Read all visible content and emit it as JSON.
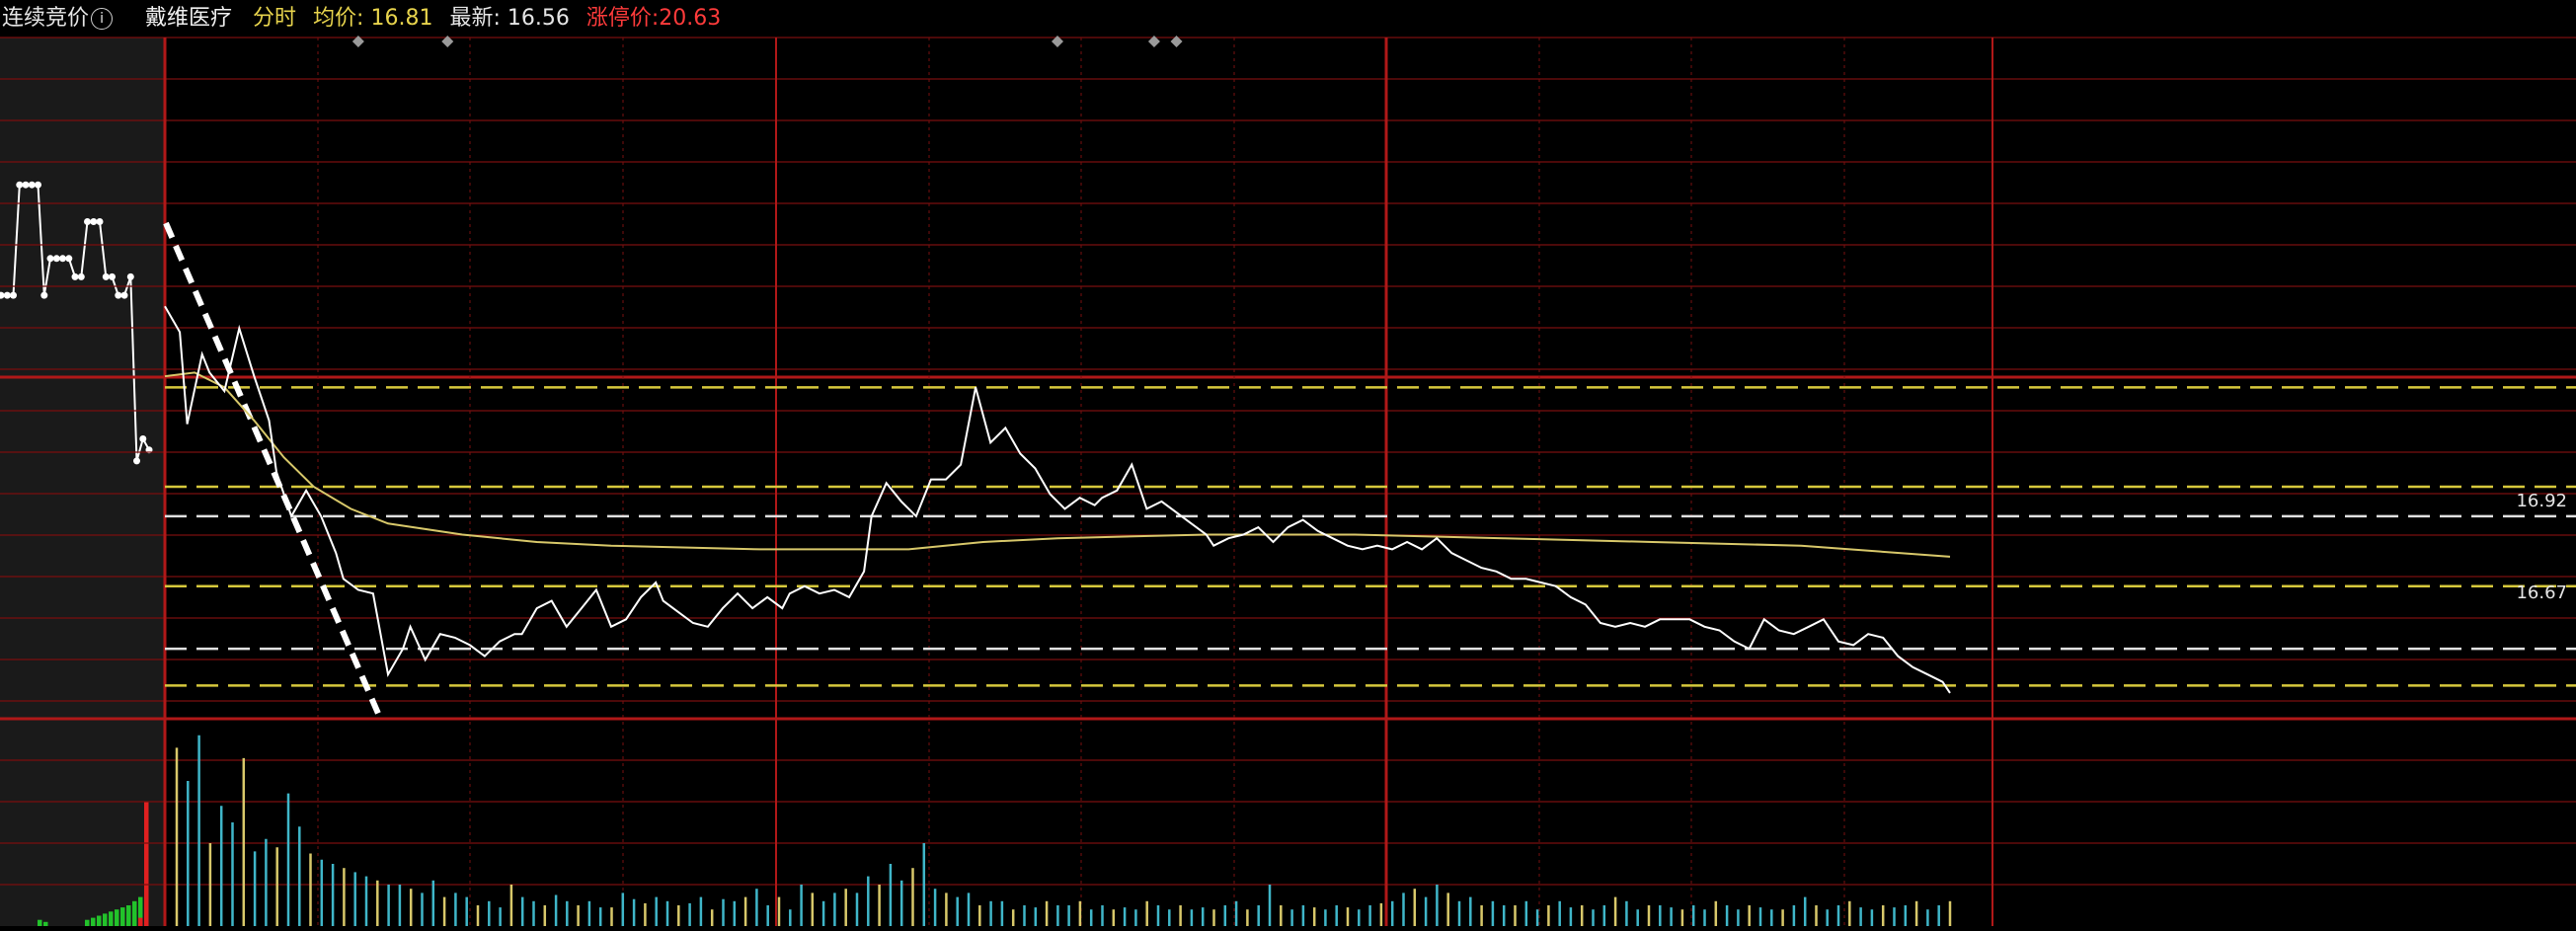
{
  "header": {
    "auction_label": "连续竞价",
    "stock_name": "戴维医疗",
    "mode_label": "分时",
    "avg_label": "均价:",
    "avg_value": "16.81",
    "last_label": "最新:",
    "last_value": "16.56",
    "limit_label": "涨停价:",
    "limit_value": "20.63"
  },
  "colors": {
    "background": "#000000",
    "grid": "#7a0f0f",
    "grid_strong": "#b01818",
    "price_line": "#ffffff",
    "avg_line": "#d8c86a",
    "dashed_white": "#e0e0e0",
    "dashed_yellow": "#d6c83c",
    "volume_cyan": "#3fb6c9",
    "volume_yellow": "#d8c86a",
    "auction_bg": "#1a1a1a",
    "auction_green": "#22c22a",
    "auction_red": "#e02020"
  },
  "chart_data": {
    "type": "line",
    "price_labels": [
      {
        "text": "16.92",
        "value": 16.92
      },
      {
        "text": "16.67",
        "value": 16.67
      }
    ],
    "horizontal_levels": [
      {
        "value": 17.27,
        "style": "yellow-dashed"
      },
      {
        "value": 17.0,
        "style": "yellow-dashed"
      },
      {
        "value": 16.92,
        "style": "white-dashed"
      },
      {
        "value": 16.73,
        "style": "yellow-dashed"
      },
      {
        "value": 16.56,
        "style": "white-dashed"
      },
      {
        "value": 16.46,
        "style": "yellow-dashed"
      }
    ],
    "price_range": [
      16.37,
      18.22
    ],
    "minutes_total": 240,
    "price": [
      [
        0,
        17.49
      ],
      [
        2,
        17.42
      ],
      [
        3,
        17.17
      ],
      [
        5,
        17.36
      ],
      [
        6,
        17.31
      ],
      [
        8,
        17.26
      ],
      [
        10,
        17.43
      ],
      [
        12,
        17.3
      ],
      [
        14,
        17.18
      ],
      [
        15,
        17.04
      ],
      [
        17,
        16.92
      ],
      [
        19,
        16.99
      ],
      [
        21,
        16.92
      ],
      [
        23,
        16.82
      ],
      [
        24,
        16.75
      ],
      [
        26,
        16.72
      ],
      [
        28,
        16.71
      ],
      [
        30,
        16.49
      ],
      [
        32,
        16.56
      ],
      [
        33,
        16.62
      ],
      [
        35,
        16.53
      ],
      [
        37,
        16.6
      ],
      [
        39,
        16.59
      ],
      [
        41,
        16.57
      ],
      [
        43,
        16.54
      ],
      [
        45,
        16.58
      ],
      [
        47,
        16.6
      ],
      [
        48,
        16.6
      ],
      [
        50,
        16.67
      ],
      [
        52,
        16.69
      ],
      [
        54,
        16.62
      ],
      [
        56,
        16.67
      ],
      [
        58,
        16.72
      ],
      [
        60,
        16.62
      ],
      [
        62,
        16.64
      ],
      [
        64,
        16.7
      ],
      [
        66,
        16.74
      ],
      [
        67,
        16.69
      ],
      [
        69,
        16.66
      ],
      [
        71,
        16.63
      ],
      [
        73,
        16.62
      ],
      [
        75,
        16.67
      ],
      [
        77,
        16.71
      ],
      [
        79,
        16.67
      ],
      [
        81,
        16.7
      ],
      [
        83,
        16.67
      ],
      [
        84,
        16.71
      ],
      [
        86,
        16.73
      ],
      [
        88,
        16.71
      ],
      [
        90,
        16.72
      ],
      [
        92,
        16.7
      ],
      [
        94,
        16.77
      ],
      [
        95,
        16.92
      ],
      [
        97,
        17.01
      ],
      [
        99,
        16.96
      ],
      [
        101,
        16.92
      ],
      [
        103,
        17.02
      ],
      [
        105,
        17.02
      ],
      [
        107,
        17.06
      ],
      [
        109,
        17.27
      ],
      [
        111,
        17.12
      ],
      [
        113,
        17.16
      ],
      [
        115,
        17.09
      ],
      [
        117,
        17.05
      ],
      [
        119,
        16.98
      ],
      [
        121,
        16.94
      ],
      [
        123,
        16.97
      ],
      [
        125,
        16.95
      ],
      [
        126,
        16.97
      ],
      [
        128,
        16.99
      ],
      [
        130,
        17.06
      ],
      [
        132,
        16.94
      ],
      [
        134,
        16.96
      ],
      [
        136,
        16.93
      ],
      [
        138,
        16.9
      ],
      [
        140,
        16.87
      ],
      [
        141,
        16.84
      ],
      [
        143,
        16.86
      ],
      [
        145,
        16.87
      ],
      [
        147,
        16.89
      ],
      [
        149,
        16.85
      ],
      [
        151,
        16.89
      ],
      [
        153,
        16.91
      ],
      [
        155,
        16.88
      ],
      [
        157,
        16.86
      ],
      [
        159,
        16.84
      ],
      [
        161,
        16.83
      ],
      [
        163,
        16.84
      ],
      [
        165,
        16.83
      ],
      [
        167,
        16.85
      ],
      [
        169,
        16.83
      ],
      [
        171,
        16.86
      ],
      [
        173,
        16.82
      ],
      [
        175,
        16.8
      ],
      [
        177,
        16.78
      ],
      [
        179,
        16.77
      ],
      [
        181,
        16.75
      ],
      [
        183,
        16.75
      ],
      [
        185,
        16.74
      ],
      [
        187,
        16.73
      ],
      [
        189,
        16.7
      ],
      [
        191,
        16.68
      ],
      [
        193,
        16.63
      ],
      [
        195,
        16.62
      ],
      [
        197,
        16.63
      ],
      [
        199,
        16.62
      ],
      [
        201,
        16.64
      ],
      [
        203,
        16.64
      ],
      [
        205,
        16.64
      ],
      [
        207,
        16.62
      ],
      [
        209,
        16.61
      ],
      [
        211,
        16.58
      ],
      [
        213,
        16.56
      ],
      [
        215,
        16.64
      ],
      [
        217,
        16.61
      ],
      [
        219,
        16.6
      ],
      [
        221,
        16.62
      ],
      [
        223,
        16.64
      ],
      [
        225,
        16.58
      ],
      [
        227,
        16.57
      ],
      [
        229,
        16.6
      ],
      [
        231,
        16.59
      ],
      [
        233,
        16.54
      ],
      [
        235,
        16.51
      ],
      [
        237,
        16.49
      ],
      [
        239,
        16.47
      ],
      [
        240,
        16.44
      ]
    ],
    "avg_price": [
      [
        0,
        17.3
      ],
      [
        4,
        17.31
      ],
      [
        8,
        17.27
      ],
      [
        12,
        17.18
      ],
      [
        16,
        17.08
      ],
      [
        20,
        17.0
      ],
      [
        25,
        16.94
      ],
      [
        30,
        16.9
      ],
      [
        40,
        16.87
      ],
      [
        50,
        16.85
      ],
      [
        60,
        16.84
      ],
      [
        80,
        16.83
      ],
      [
        100,
        16.83
      ],
      [
        110,
        16.85
      ],
      [
        120,
        16.86
      ],
      [
        140,
        16.87
      ],
      [
        160,
        16.87
      ],
      [
        180,
        16.86
      ],
      [
        200,
        16.85
      ],
      [
        220,
        16.84
      ],
      [
        240,
        16.81
      ]
    ],
    "volume": [
      86,
      70,
      92,
      40,
      58,
      50,
      81,
      36,
      42,
      38,
      64,
      48,
      35,
      32,
      30,
      28,
      26,
      24,
      22,
      20,
      20,
      18,
      16,
      22,
      14,
      16,
      14,
      10,
      12,
      9,
      20,
      14,
      12,
      10,
      15,
      12,
      10,
      12,
      9,
      9,
      16,
      13,
      11,
      14,
      12,
      10,
      11,
      14,
      8,
      13,
      12,
      14,
      18,
      10,
      14,
      8,
      20,
      16,
      12,
      16,
      18,
      16,
      24,
      20,
      30,
      22,
      28,
      40,
      18,
      16,
      14,
      16,
      10,
      12,
      12,
      8,
      10,
      9,
      12,
      10,
      10,
      12,
      8,
      10,
      8,
      9,
      8,
      12,
      10,
      8,
      10,
      8,
      9,
      8,
      10,
      12,
      8,
      10,
      20,
      10,
      8,
      10,
      9,
      8,
      10,
      9,
      8,
      10,
      11,
      12,
      16,
      18,
      14,
      20,
      16,
      12,
      14,
      10,
      12,
      10,
      10,
      12,
      8,
      10,
      12,
      9,
      10,
      8,
      10,
      14,
      12,
      8,
      10,
      10,
      9,
      8,
      10,
      8,
      12,
      10,
      8,
      10,
      9,
      8,
      8,
      10,
      14,
      10,
      8,
      10,
      12,
      9,
      8,
      10,
      9,
      10,
      12,
      8,
      10,
      12
    ],
    "volume_range": [
      0,
      100
    ],
    "auction_price": [
      [
        0,
        17.52
      ],
      [
        1,
        17.52
      ],
      [
        2,
        17.52
      ],
      [
        3,
        17.82
      ],
      [
        4,
        17.82
      ],
      [
        5,
        17.82
      ],
      [
        6,
        17.82
      ],
      [
        7,
        17.52
      ],
      [
        8,
        17.62
      ],
      [
        9,
        17.62
      ],
      [
        10,
        17.62
      ],
      [
        11,
        17.62
      ],
      [
        12,
        17.57
      ],
      [
        13,
        17.57
      ],
      [
        14,
        17.72
      ],
      [
        15,
        17.72
      ],
      [
        16,
        17.72
      ],
      [
        17,
        17.57
      ],
      [
        18,
        17.57
      ],
      [
        19,
        17.52
      ],
      [
        20,
        17.52
      ],
      [
        21,
        17.57
      ],
      [
        22,
        17.07
      ],
      [
        23,
        17.13
      ],
      [
        24,
        17.1
      ]
    ],
    "auction_volume_green": [
      0,
      0,
      0,
      0,
      0,
      0,
      3,
      2,
      0,
      0,
      0,
      0,
      0,
      0,
      3,
      4,
      5,
      6,
      7,
      8,
      9,
      10,
      12,
      14,
      16
    ],
    "auction_volume_red": [
      0,
      0,
      0,
      0,
      0,
      0,
      0,
      0,
      0,
      0,
      0,
      0,
      0,
      0,
      0,
      0,
      0,
      0,
      0,
      0,
      0,
      0,
      0,
      4,
      60
    ],
    "markers_x_min": [
      26,
      38,
      120,
      133,
      136
    ]
  }
}
